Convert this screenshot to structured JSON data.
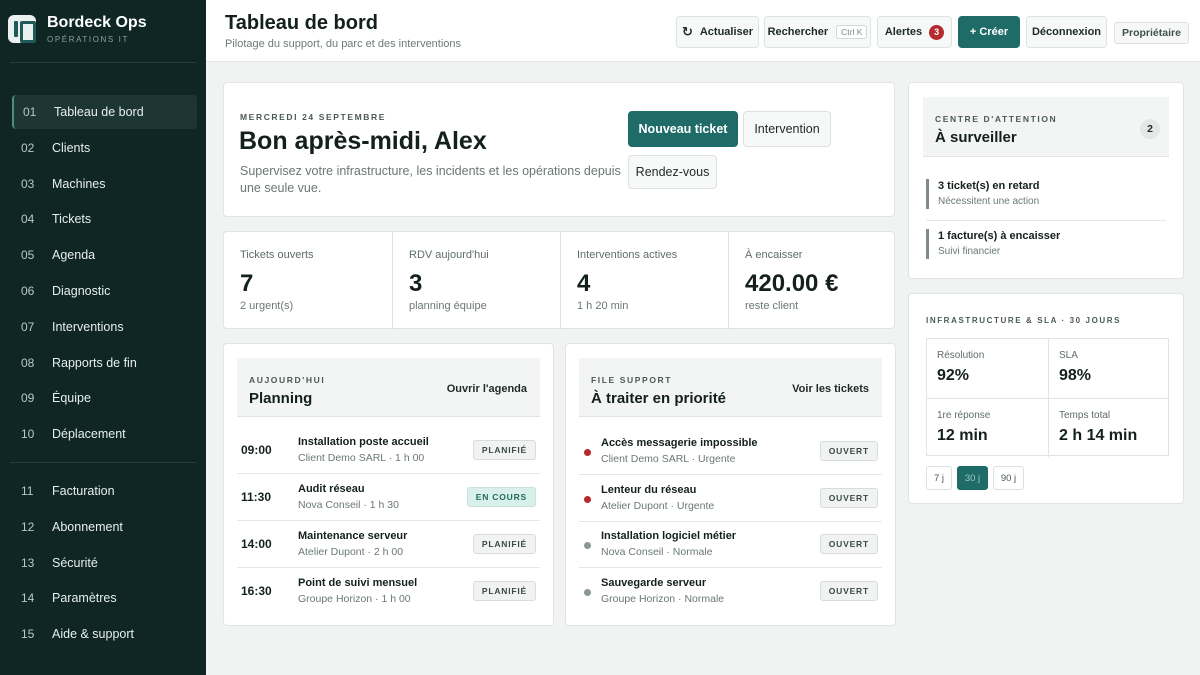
{
  "brand": {
    "name": "Bordeck Ops",
    "subtitle": "OPÉRATIONS IT"
  },
  "nav": [
    {
      "num": "01",
      "label": "Tableau de bord",
      "active": true
    },
    {
      "num": "02",
      "label": "Clients"
    },
    {
      "num": "03",
      "label": "Machines"
    },
    {
      "num": "04",
      "label": "Tickets"
    },
    {
      "num": "05",
      "label": "Agenda"
    },
    {
      "num": "06",
      "label": "Diagnostic"
    },
    {
      "num": "07",
      "label": "Interventions"
    },
    {
      "num": "08",
      "label": "Rapports de fin"
    },
    {
      "num": "09",
      "label": "Équipe"
    },
    {
      "num": "10",
      "label": "Déplacement"
    },
    {
      "num": "11",
      "label": "Facturation"
    },
    {
      "num": "12",
      "label": "Abonnement"
    },
    {
      "num": "13",
      "label": "Sécurité"
    },
    {
      "num": "14",
      "label": "Paramètres"
    },
    {
      "num": "15",
      "label": "Aide & support"
    }
  ],
  "header": {
    "title": "Tableau de bord",
    "subtitle": "Pilotage du support, du parc et des interventions",
    "refresh_label": "Actualiser",
    "search_label": "Rechercher",
    "search_shortcut": "Ctrl K",
    "alerts_label": "Alertes",
    "alerts_count": "3",
    "create_label": "+ Créer",
    "logout_label": "Déconnexion",
    "role_label": "Propriétaire"
  },
  "welcome": {
    "date": "MERCREDI 24 SEPTEMBRE",
    "greeting": "Bon après-midi, Alex",
    "description": "Supervisez votre infrastructure, les incidents et les opérations depuis une seule vue.",
    "new_ticket_label": "Nouveau ticket",
    "intervention_label": "Intervention",
    "appointment_label": "Rendez-vous"
  },
  "stats": [
    {
      "label": "Tickets ouverts",
      "value": "7",
      "note": "2 urgent(s)"
    },
    {
      "label": "RDV aujourd'hui",
      "value": "3",
      "note": "planning équipe"
    },
    {
      "label": "Interventions actives",
      "value": "4",
      "note": "1 h 20 min"
    },
    {
      "label": "À encaisser",
      "value": "420.00 €",
      "note": "reste client"
    }
  ],
  "planning": {
    "eyebrow": "AUJOURD'HUI",
    "title": "Planning",
    "link": "Ouvrir l'agenda",
    "rows": [
      {
        "time": "09:00",
        "title": "Installation poste accueil",
        "sub": "Client Demo SARL · 1 h 00",
        "status": "PLANIFIÉ",
        "state": "planned"
      },
      {
        "time": "11:30",
        "title": "Audit réseau",
        "sub": "Nova Conseil · 1 h 30",
        "status": "EN COURS",
        "state": "progress"
      },
      {
        "time": "14:00",
        "title": "Maintenance serveur",
        "sub": "Atelier Dupont · 2 h 00",
        "status": "PLANIFIÉ",
        "state": "planned"
      },
      {
        "time": "16:30",
        "title": "Point de suivi mensuel",
        "sub": "Groupe Horizon · 1 h 00",
        "status": "PLANIFIÉ",
        "state": "planned"
      }
    ]
  },
  "queue": {
    "eyebrow": "FILE SUPPORT",
    "title": "À traiter en priorité",
    "link": "Voir les tickets",
    "rows": [
      {
        "title": "Accès messagerie impossible",
        "sub": "Client Demo SARL · Urgente",
        "status": "OUVERT",
        "priority": "urgent"
      },
      {
        "title": "Lenteur du réseau",
        "sub": "Atelier Dupont · Urgente",
        "status": "OUVERT",
        "priority": "urgent"
      },
      {
        "title": "Installation logiciel métier",
        "sub": "Nova Conseil · Normale",
        "status": "OUVERT",
        "priority": "normal"
      },
      {
        "title": "Sauvegarde serveur",
        "sub": "Groupe Horizon · Normale",
        "status": "OUVERT",
        "priority": "normal"
      }
    ]
  },
  "attention": {
    "eyebrow": "CENTRE D'ATTENTION",
    "title": "À surveiller",
    "count": "2",
    "items": [
      {
        "title": "3 ticket(s) en retard",
        "sub": "Nécessitent une action"
      },
      {
        "title": "1 facture(s) à encaisser",
        "sub": "Suivi financier"
      }
    ]
  },
  "sla": {
    "eyebrow": "INFRASTRUCTURE & SLA · 30 JOURS",
    "metrics": [
      {
        "label": "Résolution",
        "value": "92%"
      },
      {
        "label": "SLA",
        "value": "98%"
      },
      {
        "label": "1re réponse",
        "value": "12 min"
      },
      {
        "label": "Temps total",
        "value": "2 h 14 min"
      }
    ],
    "periods": [
      {
        "label": "7 j",
        "active": false
      },
      {
        "label": "30 j",
        "active": true
      },
      {
        "label": "90 j",
        "active": false
      }
    ]
  },
  "colors": {
    "accent": "#1f6b67",
    "sidebar": "#0f2624",
    "urgent": "#b5292f",
    "normal": "#8a9795"
  }
}
